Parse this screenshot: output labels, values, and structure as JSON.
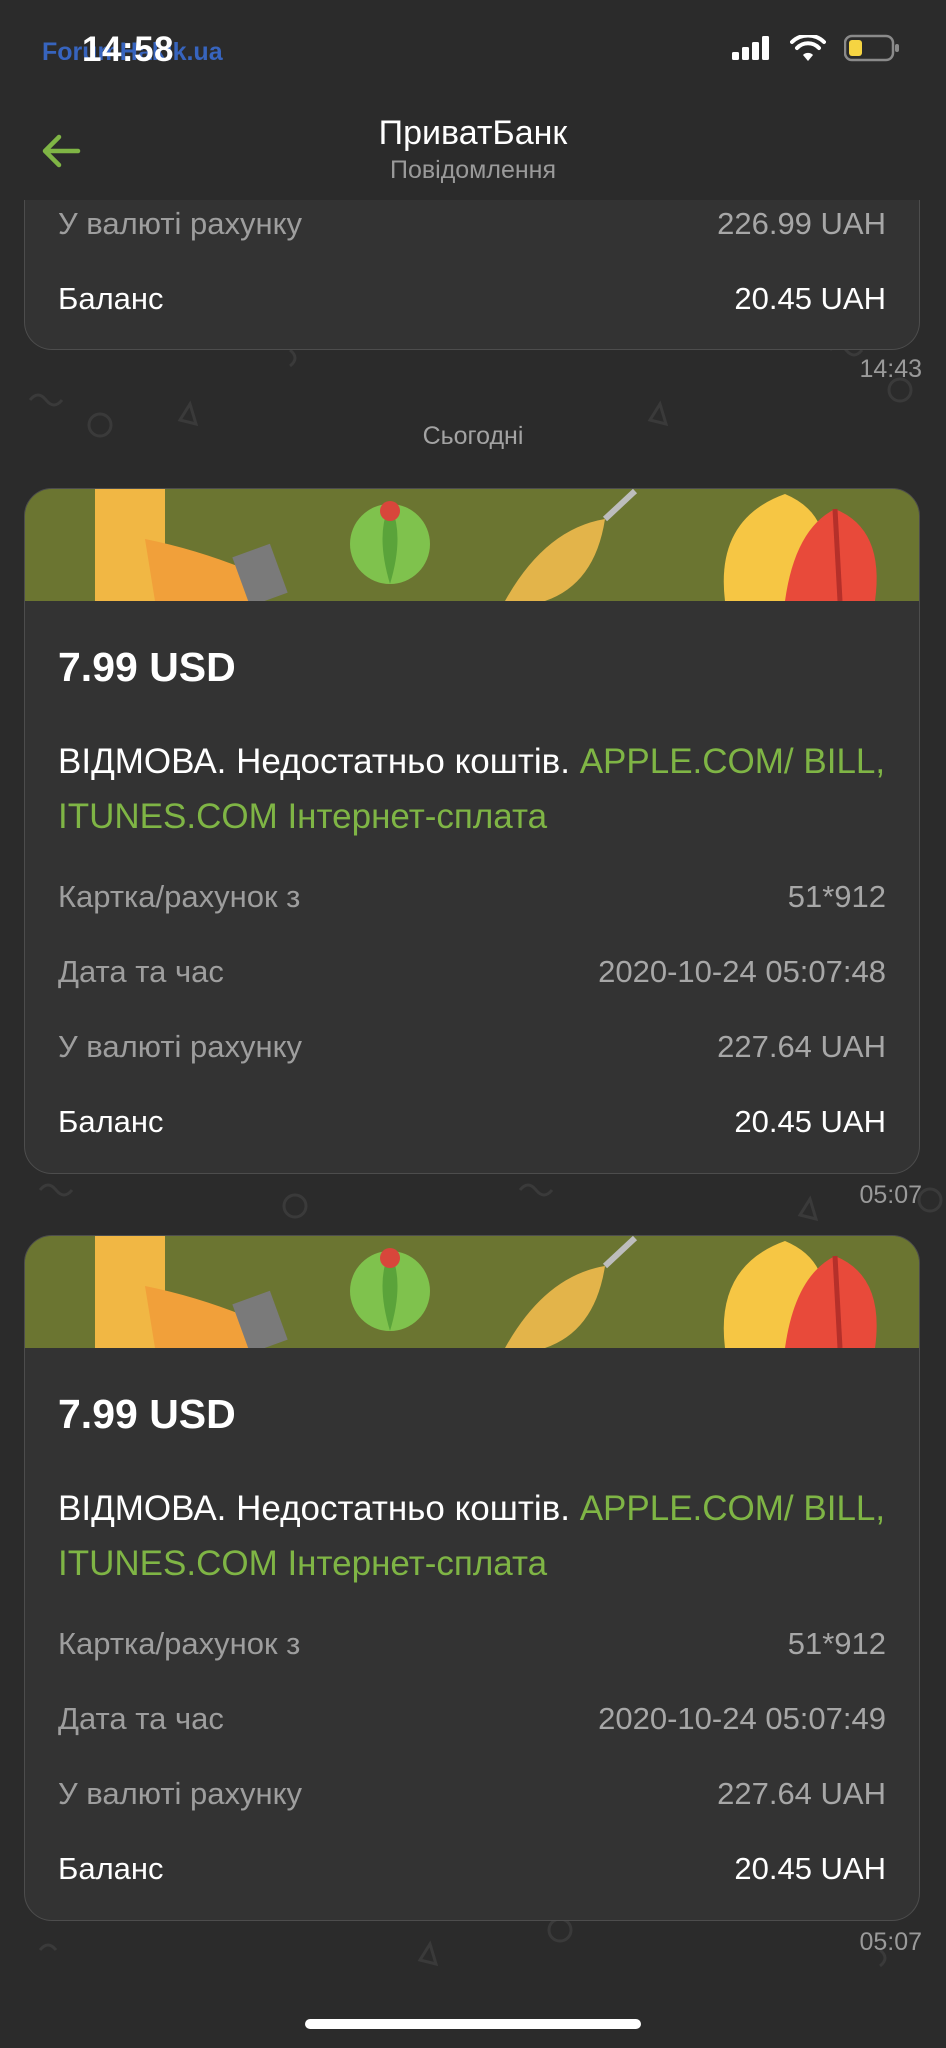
{
  "status_bar": {
    "time": "14:58",
    "watermark": "ForumHakik.ua",
    "icons": [
      "signal-icon",
      "wifi-icon",
      "battery-icon"
    ]
  },
  "header": {
    "title": "ПриватБанк",
    "subtitle": "Повідомлення",
    "back_icon": "arrow-left-icon"
  },
  "colors": {
    "background": "#2b2b2b",
    "card": "#333333",
    "accent_green": "#7fb545",
    "banner": "#6b7531"
  },
  "previous_message": {
    "rows": [
      {
        "label": "У валюті рахунку",
        "value": "226.99 UAH"
      },
      {
        "label": "Баланс",
        "value": "20.45 UAH"
      }
    ],
    "time": "14:43"
  },
  "date_separator": "Сьогодні",
  "messages": [
    {
      "amount": "7.99 USD",
      "status_text": "ВІДМОВА. Недостатньо коштів. ",
      "merchant": "APPLE.COM/ BILL, ITUNES.COM Інтернет-сплата",
      "rows": [
        {
          "label": "Картка/рахунок з",
          "value": "51*912"
        },
        {
          "label": "Дата та час",
          "value": "2020-10-24 05:07:48"
        },
        {
          "label": "У валюті рахунку",
          "value": "227.64 UAH"
        },
        {
          "label": "Баланс",
          "value": "20.45 UAH"
        }
      ],
      "time": "05:07"
    },
    {
      "amount": "7.99 USD",
      "status_text": "ВІДМОВА. Недостатньо коштів. ",
      "merchant": "APPLE.COM/ BILL, ITUNES.COM Інтернет-сплата",
      "rows": [
        {
          "label": "Картка/рахунок з",
          "value": "51*912"
        },
        {
          "label": "Дата та час",
          "value": "2020-10-24 05:07:49"
        },
        {
          "label": "У валюті рахунку",
          "value": "227.64 UAH"
        },
        {
          "label": "Баланс",
          "value": "20.45 UAH"
        }
      ],
      "time": "05:07"
    }
  ]
}
